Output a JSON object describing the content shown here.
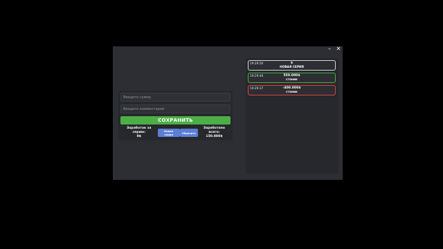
{
  "window": {
    "minimize_glyph": "–",
    "close_glyph": "✕"
  },
  "form": {
    "amount_placeholder": "Введите сумму",
    "comment_placeholder": "Введите комментарий",
    "save_label": "СОХРАНИТЬ"
  },
  "stats": {
    "series_label": "Заработок за серию:",
    "series_value": "0$",
    "new_series_button": "Новая серия",
    "reset_button": "Сбросить",
    "total_label": "Заработано всего:",
    "total_value": "150.000$"
  },
  "log": {
    "entries": [
      {
        "time": "19:29:50",
        "amount": "$",
        "label": "НОВАЯ СЕРИЯ",
        "border_color": "#d9d9d9"
      },
      {
        "time": "19:29:46",
        "amount": "550.000$",
        "label": "стоник",
        "border_color": "#4caf46"
      },
      {
        "time": "19:29:37",
        "amount": "-400.000$",
        "label": "стоник",
        "border_color": "#e04040"
      }
    ]
  },
  "colors": {
    "window_bg": "#2c2e33",
    "panel_bg": "#26282c",
    "accent_green": "#4caf46",
    "accent_blue": "#5b7fd6",
    "accent_red": "#e04040"
  }
}
